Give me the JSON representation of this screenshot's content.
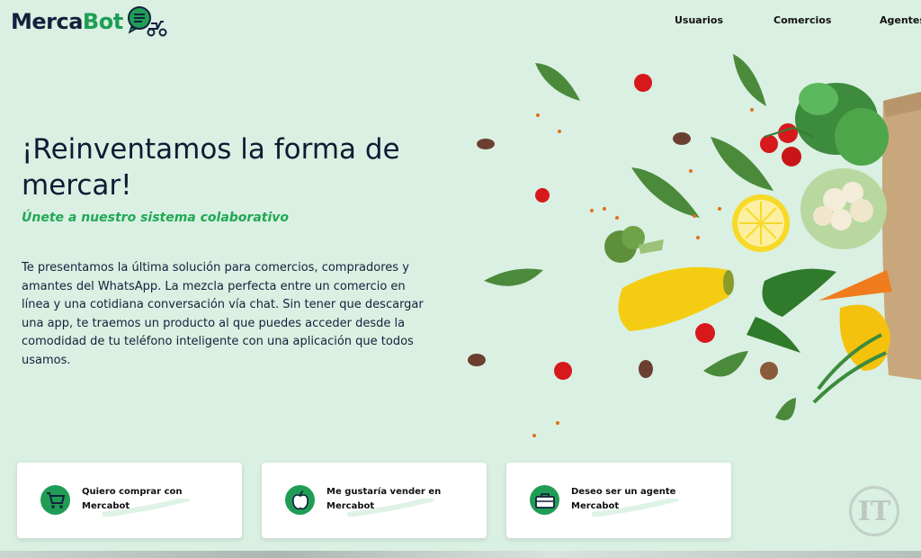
{
  "brand": {
    "name_part1": "Merca",
    "name_part2": "Bot",
    "icon": "chat-scooter-icon",
    "color_dark": "#14213d",
    "color_green": "#1f9d55"
  },
  "nav": {
    "items": [
      {
        "label": "Usuarios"
      },
      {
        "label": "Comercios"
      },
      {
        "label": "Agentes"
      }
    ]
  },
  "hero": {
    "title": "¡Reinventamos la forma de mercar!",
    "subtitle": "Únete a nuestro sistema colaborativo",
    "body": "Te presentamos la última solución para comercios, compradores y amantes del WhatsApp. La mezcla perfecta entre un comercio en línea y una cotidiana conversación vía chat. Sin tener que descargar una app, te traemos un producto al que puedes acceder desde la comodidad de tu teléfono inteligente con una aplicación que todos usamos."
  },
  "cards": [
    {
      "label": "Quiero comprar con Mercabot",
      "icon": "shopping-cart-icon"
    },
    {
      "label": "Me gustaría vender en Mercabot",
      "icon": "apple-icon"
    },
    {
      "label": "Deseo ser un agente Mercabot",
      "icon": "briefcase-icon"
    }
  ],
  "watermark": {
    "text": "IT"
  },
  "colors": {
    "background": "#daf0e2",
    "accent": "#1f9d55"
  }
}
